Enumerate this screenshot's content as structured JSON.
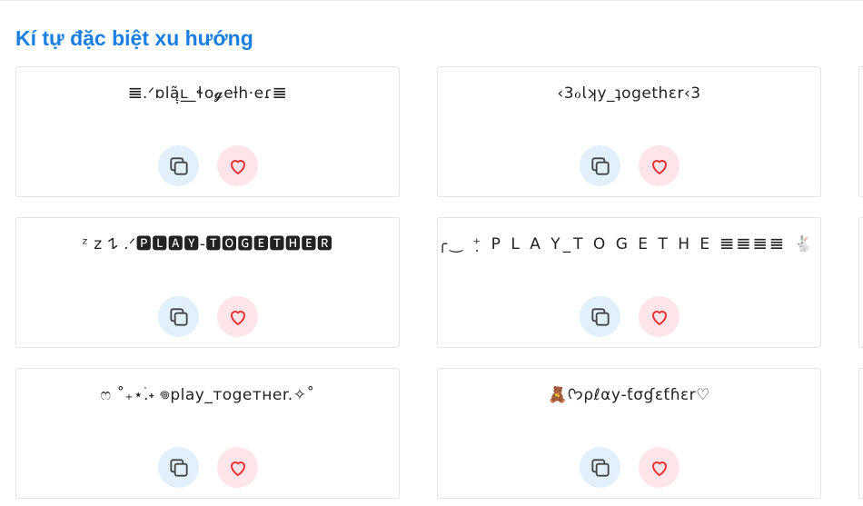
{
  "section": {
    "title": "Kí tự đặc biệt xu hướng"
  },
  "colors": {
    "title": "#1a7fe0",
    "copy_bg": "#e2f0fc",
    "copy_icon": "#444444",
    "like_bg": "#fde5ea",
    "like_icon": "#e8333a"
  },
  "icons": {
    "copy": "copy-icon",
    "like": "heart-icon"
  },
  "cards": [
    {
      "text": "𝌆.ᐟɒlą̣̃ʟ̲_ɬo𝓰eƚh·eɾ𝌆"
    },
    {
      "text": "‹3ℴ𝗅ʞy_ʇogethɛr‹3"
    },
    {
      "text": "ᶻ z 𐰁 .ᐟ🅿🅻🅰🆈-🆃🅾🅶🅴🆃🅷🅴🆁"
    },
    {
      "text": "╭‿ ⁺̣ P L A Y_T O G E T H E 𝌆𝌆𝌆𝌆 🐇 ₊˚ෆ"
    },
    {
      "text": "ෆ ˚₊⋆࣪.˖ 𖦹play_тogeтнer.✧˚"
    },
    {
      "text": "🧸ᢉ𐭩ρℓαу-ƭσɠεƭɦεr♡"
    }
  ]
}
